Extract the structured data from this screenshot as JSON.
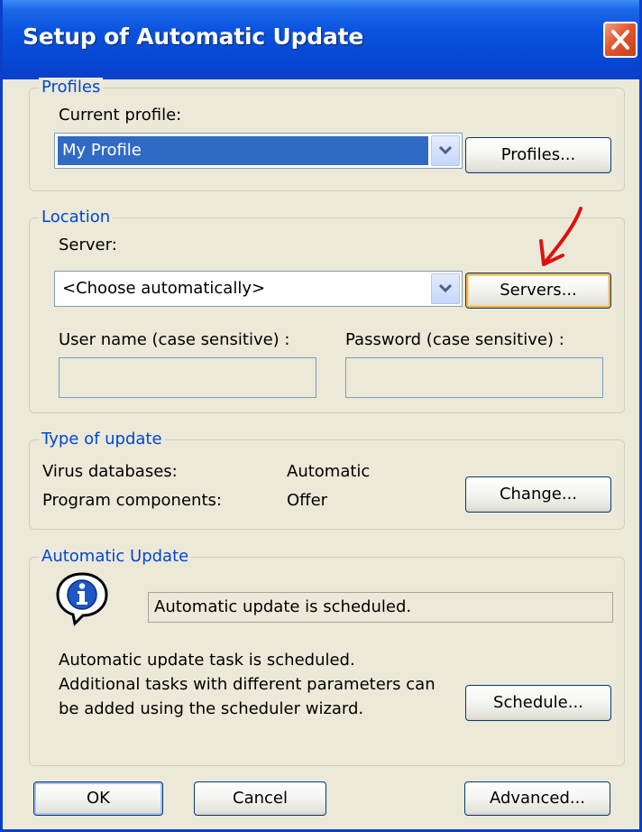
{
  "window": {
    "title": "Setup of Automatic Update"
  },
  "profiles": {
    "legend": "Profiles",
    "current_profile_label": "Current profile:",
    "selected_profile": "My Profile",
    "profiles_button": "Profiles..."
  },
  "location": {
    "legend": "Location",
    "server_label": "Server:",
    "server_value": "<Choose automatically>",
    "servers_button": "Servers...",
    "username_label": "User name (case sensitive) :",
    "username_value": "",
    "password_label": "Password (case sensitive) :",
    "password_value": ""
  },
  "type_of_update": {
    "legend": "Type of update",
    "rows": [
      {
        "label": "Virus databases:",
        "value": "Automatic"
      },
      {
        "label": "Program components:",
        "value": "Offer"
      }
    ],
    "change_button": "Change..."
  },
  "automatic_update": {
    "legend": "Automatic Update",
    "status_text": "Automatic update is scheduled.",
    "description_lines": [
      "Automatic update task is scheduled.",
      "Additional tasks with different parameters can",
      "be added using the scheduler wizard."
    ],
    "schedule_button": "Schedule..."
  },
  "footer": {
    "ok_button": "OK",
    "cancel_button": "Cancel",
    "advanced_button": "Advanced..."
  },
  "icons": {
    "info": "info-icon",
    "close": "close-icon",
    "dropdown": "chevron-down-icon",
    "annotation": "red-arrow-annotation"
  },
  "colors": {
    "title_bar": "#0548d4",
    "legend_text": "#0046d5",
    "selection": "#316ac5",
    "close_button": "#e2552f",
    "annotation": "#e01010"
  }
}
